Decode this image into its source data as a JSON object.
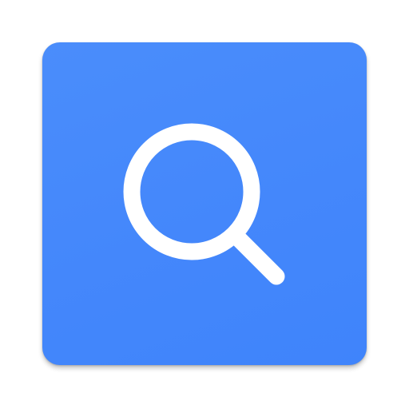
{
  "app_icon": {
    "icon": "search-icon",
    "tile_color": "#4487fb",
    "glyph_color": "#ffffff"
  }
}
